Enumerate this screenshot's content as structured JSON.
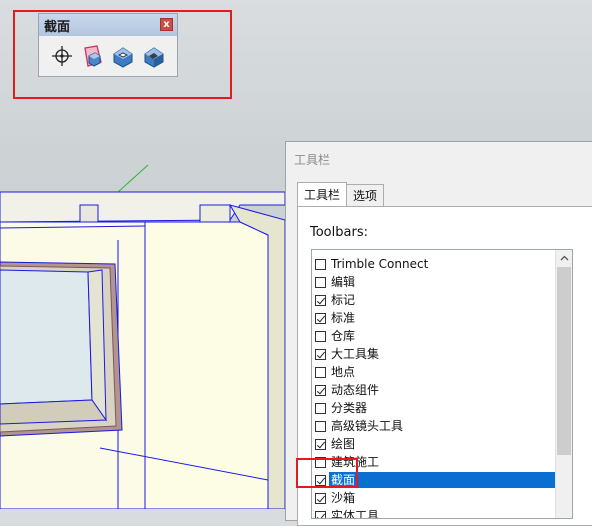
{
  "section_toolbar": {
    "title": "截面",
    "close_glyph": "x",
    "buttons": [
      {
        "icon": "section-plane-icon"
      },
      {
        "icon": "display-section-planes-icon"
      },
      {
        "icon": "display-section-cuts-icon"
      },
      {
        "icon": "display-section-fill-icon"
      }
    ]
  },
  "dialog": {
    "title": "工具栏",
    "tabs": [
      {
        "label": "工具栏",
        "active": true
      },
      {
        "label": "选项",
        "active": false
      }
    ],
    "toolbars_label": "Toolbars:",
    "items": [
      {
        "label": "Trimble Connect",
        "checked": false
      },
      {
        "label": "编辑",
        "checked": false
      },
      {
        "label": "标记",
        "checked": true
      },
      {
        "label": "标准",
        "checked": true
      },
      {
        "label": "仓库",
        "checked": false
      },
      {
        "label": "大工具集",
        "checked": true
      },
      {
        "label": "地点",
        "checked": false
      },
      {
        "label": "动态组件",
        "checked": true
      },
      {
        "label": "分类器",
        "checked": false
      },
      {
        "label": "高级镜头工具",
        "checked": false
      },
      {
        "label": "绘图",
        "checked": true
      },
      {
        "label": "建筑施工",
        "checked": false
      },
      {
        "label": "截面",
        "checked": true,
        "selected": true
      },
      {
        "label": "沙箱",
        "checked": true
      },
      {
        "label": "实体工具",
        "checked": true
      }
    ]
  },
  "colors": {
    "highlight_red": "#e21b22",
    "selection_blue": "#0a6fd1",
    "model_edge_blue": "#1a1ae6"
  }
}
